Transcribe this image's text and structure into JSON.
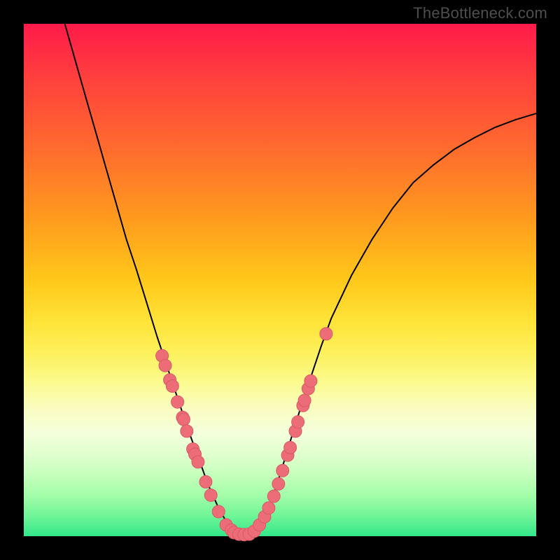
{
  "attribution": "TheBottleneck.com",
  "colors": {
    "curve_stroke": "#000000",
    "point_fill": "#ec6d77",
    "point_stroke": "#d85a66"
  },
  "chart_data": {
    "type": "line",
    "title": "",
    "xlabel": "",
    "ylabel": "",
    "xlim": [
      0,
      1
    ],
    "ylim": [
      0,
      1
    ],
    "series": [
      {
        "name": "bottleneck-curve",
        "x": [
          0.08,
          0.1,
          0.12,
          0.14,
          0.16,
          0.18,
          0.2,
          0.22,
          0.24,
          0.26,
          0.28,
          0.3,
          0.32,
          0.34,
          0.36,
          0.38,
          0.4,
          0.42,
          0.44,
          0.46,
          0.48,
          0.5,
          0.52,
          0.54,
          0.56,
          0.58,
          0.6,
          0.64,
          0.68,
          0.72,
          0.76,
          0.8,
          0.84,
          0.88,
          0.92,
          0.96,
          1.0
        ],
        "y": [
          1.0,
          0.93,
          0.86,
          0.79,
          0.72,
          0.65,
          0.58,
          0.52,
          0.455,
          0.39,
          0.33,
          0.27,
          0.21,
          0.155,
          0.1,
          0.055,
          0.02,
          0.005,
          0.005,
          0.02,
          0.06,
          0.12,
          0.185,
          0.25,
          0.31,
          0.37,
          0.425,
          0.51,
          0.58,
          0.64,
          0.69,
          0.725,
          0.755,
          0.778,
          0.798,
          0.813,
          0.825
        ]
      }
    ],
    "points": [
      {
        "x": 0.27,
        "y": 0.352
      },
      {
        "x": 0.276,
        "y": 0.333
      },
      {
        "x": 0.285,
        "y": 0.305
      },
      {
        "x": 0.29,
        "y": 0.293
      },
      {
        "x": 0.3,
        "y": 0.262
      },
      {
        "x": 0.31,
        "y": 0.232
      },
      {
        "x": 0.312,
        "y": 0.228
      },
      {
        "x": 0.318,
        "y": 0.205
      },
      {
        "x": 0.33,
        "y": 0.17
      },
      {
        "x": 0.334,
        "y": 0.16
      },
      {
        "x": 0.34,
        "y": 0.145
      },
      {
        "x": 0.355,
        "y": 0.106
      },
      {
        "x": 0.365,
        "y": 0.08
      },
      {
        "x": 0.38,
        "y": 0.048
      },
      {
        "x": 0.395,
        "y": 0.022
      },
      {
        "x": 0.405,
        "y": 0.012
      },
      {
        "x": 0.41,
        "y": 0.007
      },
      {
        "x": 0.42,
        "y": 0.004
      },
      {
        "x": 0.43,
        "y": 0.003
      },
      {
        "x": 0.44,
        "y": 0.004
      },
      {
        "x": 0.45,
        "y": 0.01
      },
      {
        "x": 0.46,
        "y": 0.022
      },
      {
        "x": 0.47,
        "y": 0.038
      },
      {
        "x": 0.478,
        "y": 0.055
      },
      {
        "x": 0.488,
        "y": 0.078
      },
      {
        "x": 0.497,
        "y": 0.102
      },
      {
        "x": 0.505,
        "y": 0.128
      },
      {
        "x": 0.515,
        "y": 0.158
      },
      {
        "x": 0.52,
        "y": 0.173
      },
      {
        "x": 0.53,
        "y": 0.205
      },
      {
        "x": 0.535,
        "y": 0.223
      },
      {
        "x": 0.545,
        "y": 0.255
      },
      {
        "x": 0.548,
        "y": 0.265
      },
      {
        "x": 0.555,
        "y": 0.288
      },
      {
        "x": 0.56,
        "y": 0.303
      },
      {
        "x": 0.59,
        "y": 0.395
      }
    ]
  }
}
